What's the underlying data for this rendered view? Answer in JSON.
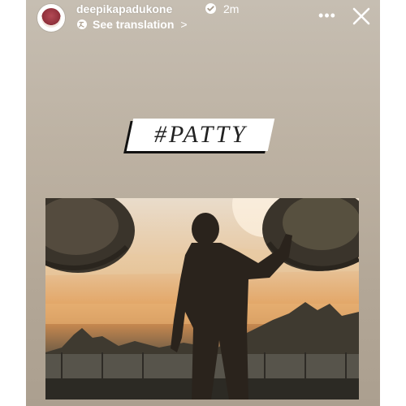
{
  "story": {
    "username": "deepikapadukone",
    "time": "2m",
    "translate_label": "See translation",
    "chevron": ">",
    "more_label": "•••",
    "sticker_text": "#PATTY",
    "icons": {
      "avatar": "profile-avatar",
      "verified": "verified-badge-icon",
      "translate": "translate-icon",
      "more": "more-options-icon",
      "close": "close-icon"
    },
    "colors": {
      "background": "#bdb2a3",
      "text": "#ffffff",
      "sticker_bg": "#ffffff",
      "sticker_text": "#222222"
    }
  }
}
